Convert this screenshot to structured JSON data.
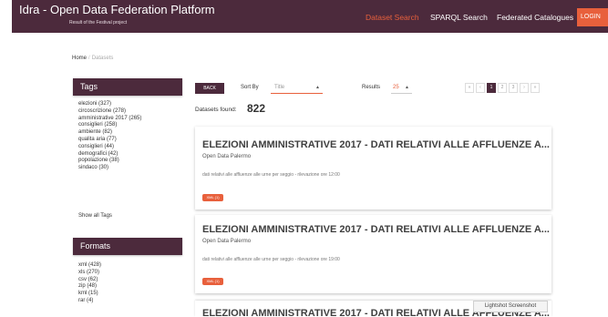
{
  "header": {
    "title": "Idra - Open Data Federation Platform",
    "subtitle": "Result of the Festival project",
    "nav": [
      "Dataset Search",
      "SPARQL Search",
      "Federated Catalogues"
    ],
    "login_label": "LOGIN",
    "accent_color": "#e8603c",
    "brand_color": "#4c2a3c"
  },
  "breadcrumb": {
    "home": "Home",
    "current": "Datasets"
  },
  "tags": {
    "title": "Tags",
    "items": [
      "elezioni (327)",
      "circoscrizione (278)",
      "amministrative 2017 (265)",
      "consiglieri (258)",
      "ambiente (82)",
      "qualita aria (77)",
      "consiglieri (44)",
      "demografici (42)",
      "popolazione (38)",
      "sindaco (30)"
    ],
    "show_all": "Show all Tags"
  },
  "formats": {
    "title": "Formats",
    "items": [
      "xml (428)",
      "xls (270)",
      "csv (62)",
      "zip (48)",
      "kml (15)",
      "rar (4)"
    ]
  },
  "toolbar": {
    "back_label": "BACK",
    "sort_label": "Sort By",
    "sort_value": "Title",
    "results_label": "Results",
    "results_value": "25"
  },
  "pagination": [
    "«",
    "‹",
    "1",
    "2",
    "3",
    "›",
    "»"
  ],
  "found": {
    "label": "Datasets found:",
    "count": "822"
  },
  "datasets": [
    {
      "title": "ELEZIONI AMMINISTRATIVE 2017 - DATI RELATIVI ALLE AFFLUENZE A...",
      "org": "Open Data Palermo",
      "desc": "dati relativi alle affluenze alle urne per seggio - rilevazione ore 12:00",
      "badge": "XML (1)"
    },
    {
      "title": "ELEZIONI AMMINISTRATIVE 2017 - DATI RELATIVI ALLE AFFLUENZE A...",
      "org": "Open Data Palermo",
      "desc": "dati relativi alle affluenze alle urne per seggio - rilevazione ore 19:00",
      "badge": "XML (1)"
    },
    {
      "title": "ELEZIONI AMMINISTRATIVE 2017 - DATI RELATIVI ALLE AFFLUENZE A..."
    }
  ],
  "overlay": {
    "lightshot": "Lightshot Screenshot"
  }
}
